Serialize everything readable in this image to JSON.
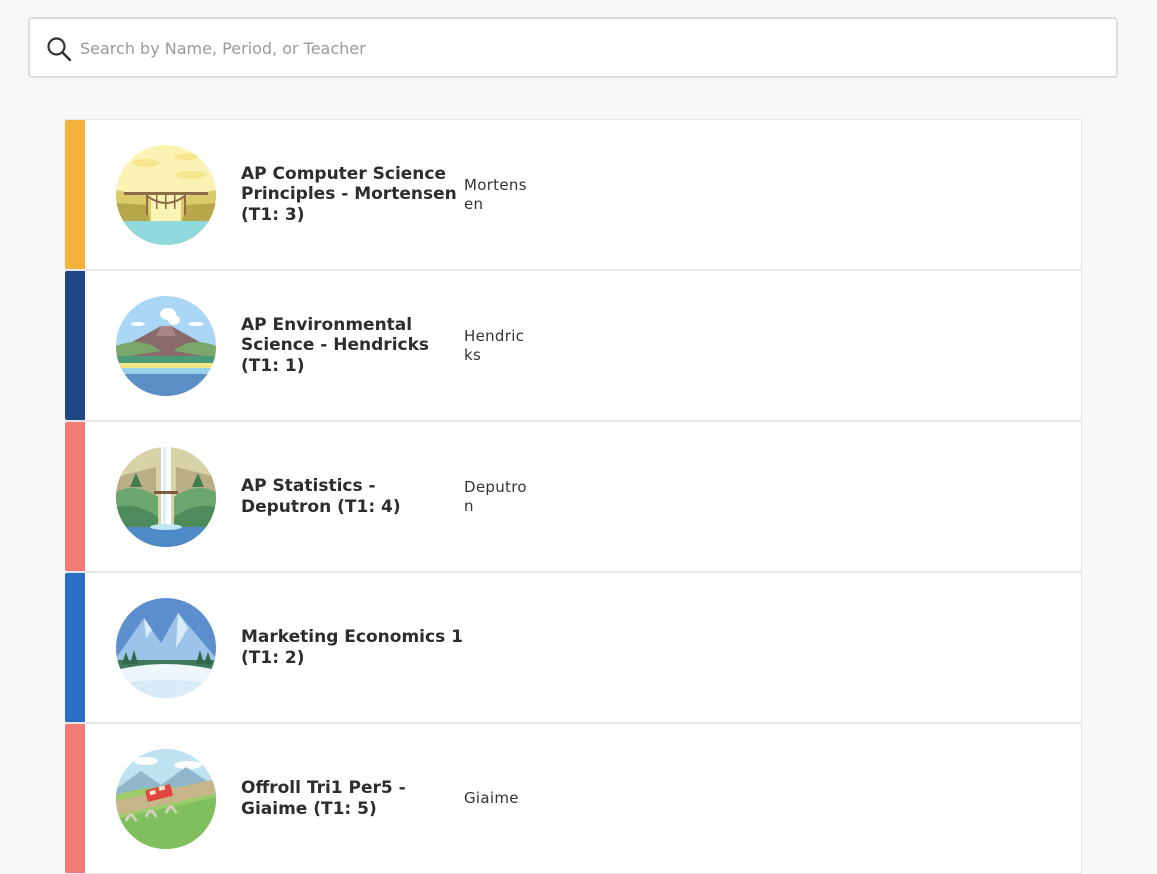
{
  "search": {
    "placeholder": "Search by Name, Period, or Teacher",
    "value": ""
  },
  "classes": [
    {
      "title": "AP Computer Science Principles - Mortensen (T1: 3)",
      "teacher": "Mortensen",
      "accent_color": "#f3b33a",
      "image": "bridge-landscape-illustration"
    },
    {
      "title": "AP Environmental Science - Hendricks (T1: 1)",
      "teacher": "Hendricks",
      "accent_color": "#1e4784",
      "image": "volcano-landscape-illustration"
    },
    {
      "title": "AP Statistics - Deputron (T1: 4)",
      "teacher": "Deputron",
      "accent_color": "#f47b78",
      "image": "waterfall-landscape-illustration"
    },
    {
      "title": "Marketing Economics 1 (T1: 2)",
      "teacher": "",
      "accent_color": "#2a6dc3",
      "image": "mountain-snow-landscape-illustration"
    },
    {
      "title": "Offroll Tri1 Per5 - Giaime (T1: 5)",
      "teacher": "Giaime",
      "accent_color": "#f47b78",
      "image": "train-viaduct-landscape-illustration"
    }
  ]
}
